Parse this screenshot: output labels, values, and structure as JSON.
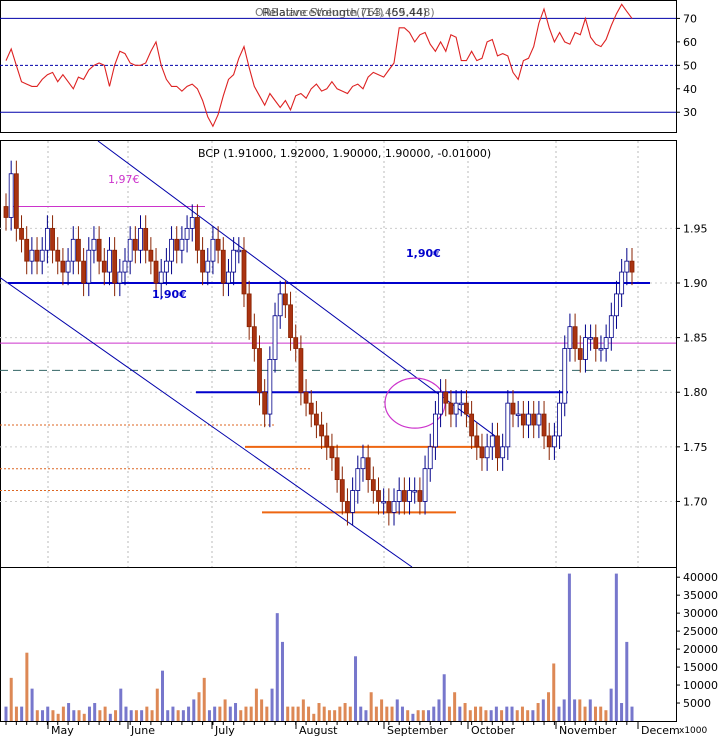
{
  "chart_data": [
    {
      "panel": "rsi",
      "type": "line",
      "title": "Relative Strength (14) (69.44)",
      "overlay_title_garble": "ORBalanceVolume(763,455,448)",
      "y_ticks": [
        "70",
        "60",
        "50",
        "40",
        "30"
      ],
      "y_tick_values": [
        70,
        60,
        50,
        40,
        30
      ],
      "ylim": [
        22,
        77
      ],
      "reference_lines": [
        70,
        50,
        30
      ],
      "series": [
        {
          "values": [
            52,
            57,
            50,
            43,
            42,
            41,
            41,
            44,
            46,
            47,
            43,
            46,
            43,
            40,
            45,
            44,
            48,
            50,
            51,
            50,
            41,
            50,
            56,
            55,
            51,
            50,
            50,
            51,
            56,
            60,
            50,
            44,
            41,
            41,
            39,
            41,
            42,
            40,
            35,
            28,
            24,
            29,
            37,
            44,
            46,
            53,
            58,
            49,
            41,
            37,
            33,
            38,
            35,
            32,
            35,
            31,
            37,
            38,
            36,
            40,
            42,
            39,
            40,
            43,
            40,
            39,
            38,
            41,
            42,
            40,
            45,
            47,
            46,
            45,
            48,
            51,
            66,
            66,
            64,
            60,
            63,
            64,
            59,
            56,
            60,
            56,
            63,
            62,
            52,
            52,
            56,
            52,
            53,
            60,
            61,
            54,
            55,
            54,
            47,
            44,
            52,
            53,
            58,
            68,
            74,
            66,
            60,
            64,
            60,
            59,
            64,
            63,
            70,
            62,
            59,
            58,
            61,
            67,
            72,
            76,
            73,
            70
          ]
        }
      ]
    },
    {
      "panel": "price",
      "type": "ohlc",
      "title": "BCP (1.91000, 1.92000, 1.90000, 1.90000, -0.01000)",
      "y_ticks": [
        "1.95",
        "1.90",
        "1.85",
        "1.80",
        "1.75",
        "1.70"
      ],
      "y_tick_values": [
        1.95,
        1.9,
        1.85,
        1.8,
        1.75,
        1.7
      ],
      "ylim": [
        1.64,
        2.03
      ],
      "annotations": [
        "1,97€",
        "1,90€",
        "1,90€"
      ],
      "levels": {
        "support_190": 1.9,
        "resistance_180": 1.8,
        "magenta_197": 1.97,
        "magenta_1845": 1.845,
        "teal_dashed": 1.82,
        "orange_175": 1.75,
        "orange_169": 1.69,
        "orange_dotted_177": 1.77,
        "orange_dotted_173": 1.73
      },
      "close": [
        1.96,
        2.0,
        1.95,
        1.94,
        1.92,
        1.93,
        1.92,
        1.93,
        1.95,
        1.93,
        1.92,
        1.91,
        1.92,
        1.94,
        1.92,
        1.9,
        1.93,
        1.94,
        1.92,
        1.91,
        1.93,
        1.9,
        1.91,
        1.92,
        1.94,
        1.93,
        1.95,
        1.93,
        1.92,
        1.9,
        1.91,
        1.92,
        1.94,
        1.93,
        1.94,
        1.95,
        1.96,
        1.93,
        1.91,
        1.92,
        1.94,
        1.93,
        1.9,
        1.91,
        1.93,
        1.93,
        1.89,
        1.86,
        1.84,
        1.8,
        1.78,
        1.83,
        1.87,
        1.89,
        1.88,
        1.85,
        1.84,
        1.8,
        1.79,
        1.78,
        1.77,
        1.76,
        1.75,
        1.74,
        1.72,
        1.7,
        1.69,
        1.71,
        1.73,
        1.74,
        1.72,
        1.71,
        1.7,
        1.7,
        1.69,
        1.7,
        1.71,
        1.7,
        1.71,
        1.71,
        1.7,
        1.73,
        1.75,
        1.78,
        1.8,
        1.79,
        1.78,
        1.79,
        1.79,
        1.78,
        1.76,
        1.75,
        1.74,
        1.75,
        1.76,
        1.74,
        1.75,
        1.79,
        1.78,
        1.78,
        1.77,
        1.78,
        1.77,
        1.78,
        1.76,
        1.75,
        1.76,
        1.79,
        1.84,
        1.86,
        1.84,
        1.83,
        1.85,
        1.85,
        1.84,
        1.84,
        1.85,
        1.87,
        1.89,
        1.91,
        1.92,
        1.91
      ]
    },
    {
      "panel": "volume",
      "type": "bar",
      "y_ticks": [
        "40000",
        "35000",
        "30000",
        "25000",
        "20000",
        "15000",
        "10000",
        "5000"
      ],
      "y_tick_values": [
        40000,
        35000,
        30000,
        25000,
        20000,
        15000,
        10000,
        5000
      ],
      "unit_label": "x1000",
      "ylim": [
        0,
        42000
      ],
      "colors": {
        "up": "#7777cc",
        "down": "#dd8855"
      },
      "values": [
        4000,
        12000,
        4000,
        4000,
        19000,
        9000,
        3000,
        3000,
        4000,
        3000,
        2000,
        4000,
        5000,
        3000,
        3000,
        2000,
        4000,
        5000,
        3000,
        4000,
        2000,
        3000,
        9000,
        4000,
        3000,
        3000,
        3000,
        4000,
        3000,
        9000,
        14000,
        3000,
        4000,
        3000,
        3000,
        4000,
        6000,
        8000,
        12000,
        3000,
        4000,
        4000,
        6000,
        4000,
        5000,
        3000,
        4000,
        4000,
        9000,
        6000,
        4000,
        9000,
        30000,
        22000,
        4000,
        4000,
        4000,
        6000,
        4000,
        2000,
        5000,
        4000,
        3000,
        3000,
        4000,
        5000,
        4000,
        18000,
        4000,
        3000,
        8000,
        4000,
        6000,
        4000,
        4000,
        6000,
        4000,
        3000,
        2000,
        3000,
        3000,
        3000,
        4000,
        6000,
        13000,
        4000,
        8000,
        4000,
        5000,
        3000,
        4000,
        4000,
        3000,
        3000,
        4000,
        3000,
        4000,
        4000,
        3000,
        4000,
        3000,
        3000,
        5000,
        6000,
        8000,
        16000,
        4000,
        6000,
        41000,
        6000,
        6000,
        4000,
        6000,
        4000,
        4000,
        3000,
        9000,
        41000,
        5000,
        22000,
        4000
      ],
      "up": [
        1,
        0,
        0,
        1,
        0,
        1,
        0,
        1,
        1,
        0,
        0,
        0,
        1,
        1,
        0,
        0,
        1,
        1,
        0,
        0,
        1,
        0,
        1,
        1,
        1,
        0,
        1,
        0,
        0,
        0,
        1,
        1,
        1,
        0,
        1,
        1,
        1,
        0,
        0,
        1,
        1,
        0,
        0,
        1,
        1,
        0,
        0,
        0,
        0,
        0,
        0,
        1,
        1,
        1,
        0,
        0,
        0,
        0,
        0,
        0,
        0,
        0,
        0,
        0,
        0,
        0,
        0,
        1,
        1,
        1,
        0,
        0,
        0,
        0,
        0,
        1,
        1,
        0,
        1,
        0,
        0,
        1,
        1,
        1,
        1,
        0,
        0,
        1,
        0,
        0,
        0,
        0,
        0,
        1,
        1,
        0,
        1,
        1,
        0,
        0,
        0,
        1,
        0,
        1,
        0,
        0,
        1,
        1,
        1,
        1,
        0,
        0,
        1,
        0,
        0,
        0,
        1,
        1,
        1,
        1,
        1,
        0
      ]
    }
  ],
  "x_axis": {
    "months": [
      "May",
      "June",
      "July",
      "August",
      "September",
      "October",
      "November",
      "Decem"
    ]
  }
}
